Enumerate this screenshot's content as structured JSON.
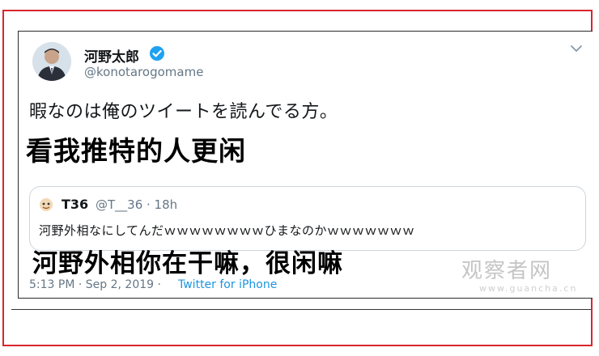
{
  "tweet": {
    "author_name": "河野太郎",
    "handle": "@konotarogomame",
    "text": "暇なのは俺のツイートを読んでる方。",
    "timestamp": "5:13 PM · Sep 2, 2019 · ",
    "via": "Twitter for iPhone"
  },
  "captions": {
    "main": "看我推特的人更闲",
    "quote": "河野外相你在干嘛，很闲嘛"
  },
  "quote": {
    "name": "T36",
    "meta": "@T__36 · 18h",
    "text": "河野外相なにしてんだｗｗｗｗｗｗｗｗひまなのかｗｗｗｗｗｗｗ"
  },
  "watermark": {
    "brand": "观察者网",
    "url": "www.guancha.cn"
  },
  "colors": {
    "frame": "#d9262c",
    "verified": "#1da1f2",
    "link": "#1b95e0",
    "muted": "#657786"
  },
  "icons": [
    "verified-badge-icon",
    "chevron-down-icon"
  ]
}
